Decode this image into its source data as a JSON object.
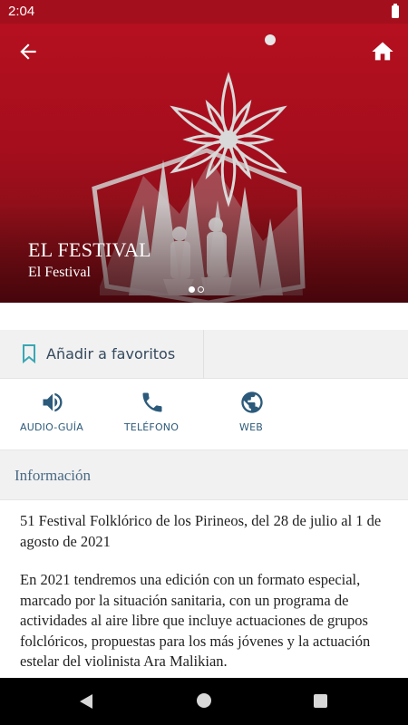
{
  "status_bar": {
    "time": "2:04"
  },
  "hero": {
    "title": "EL FESTIVAL",
    "subtitle": "El Festival",
    "page_count": 2,
    "active_page": 1
  },
  "favorites": {
    "label": "Añadir a favoritos"
  },
  "actions": [
    {
      "label": "AUDIO-GUÍA",
      "icon": "speaker-icon"
    },
    {
      "label": "TELÉFONO",
      "icon": "phone-icon"
    },
    {
      "label": "WEB",
      "icon": "globe-icon"
    }
  ],
  "info": {
    "title": "Información",
    "paragraphs": [
      "51 Festival Folklórico de los Pirineos, del 28 de julio al 1 de agosto de 2021",
      "En 2021 tendremos una edición con un formato especial, marcado por la situación sanitaria, con un programa de actividades al aire libre que incluye actuaciones de grupos folclóricos, propuestas para los más jóvenes y la actuación estelar del violinista Ara Malikian."
    ]
  },
  "colors": {
    "hero_red": "#a50e1d",
    "accent_blue": "#2c5a7a",
    "panel_gray": "#f1f1f1"
  }
}
